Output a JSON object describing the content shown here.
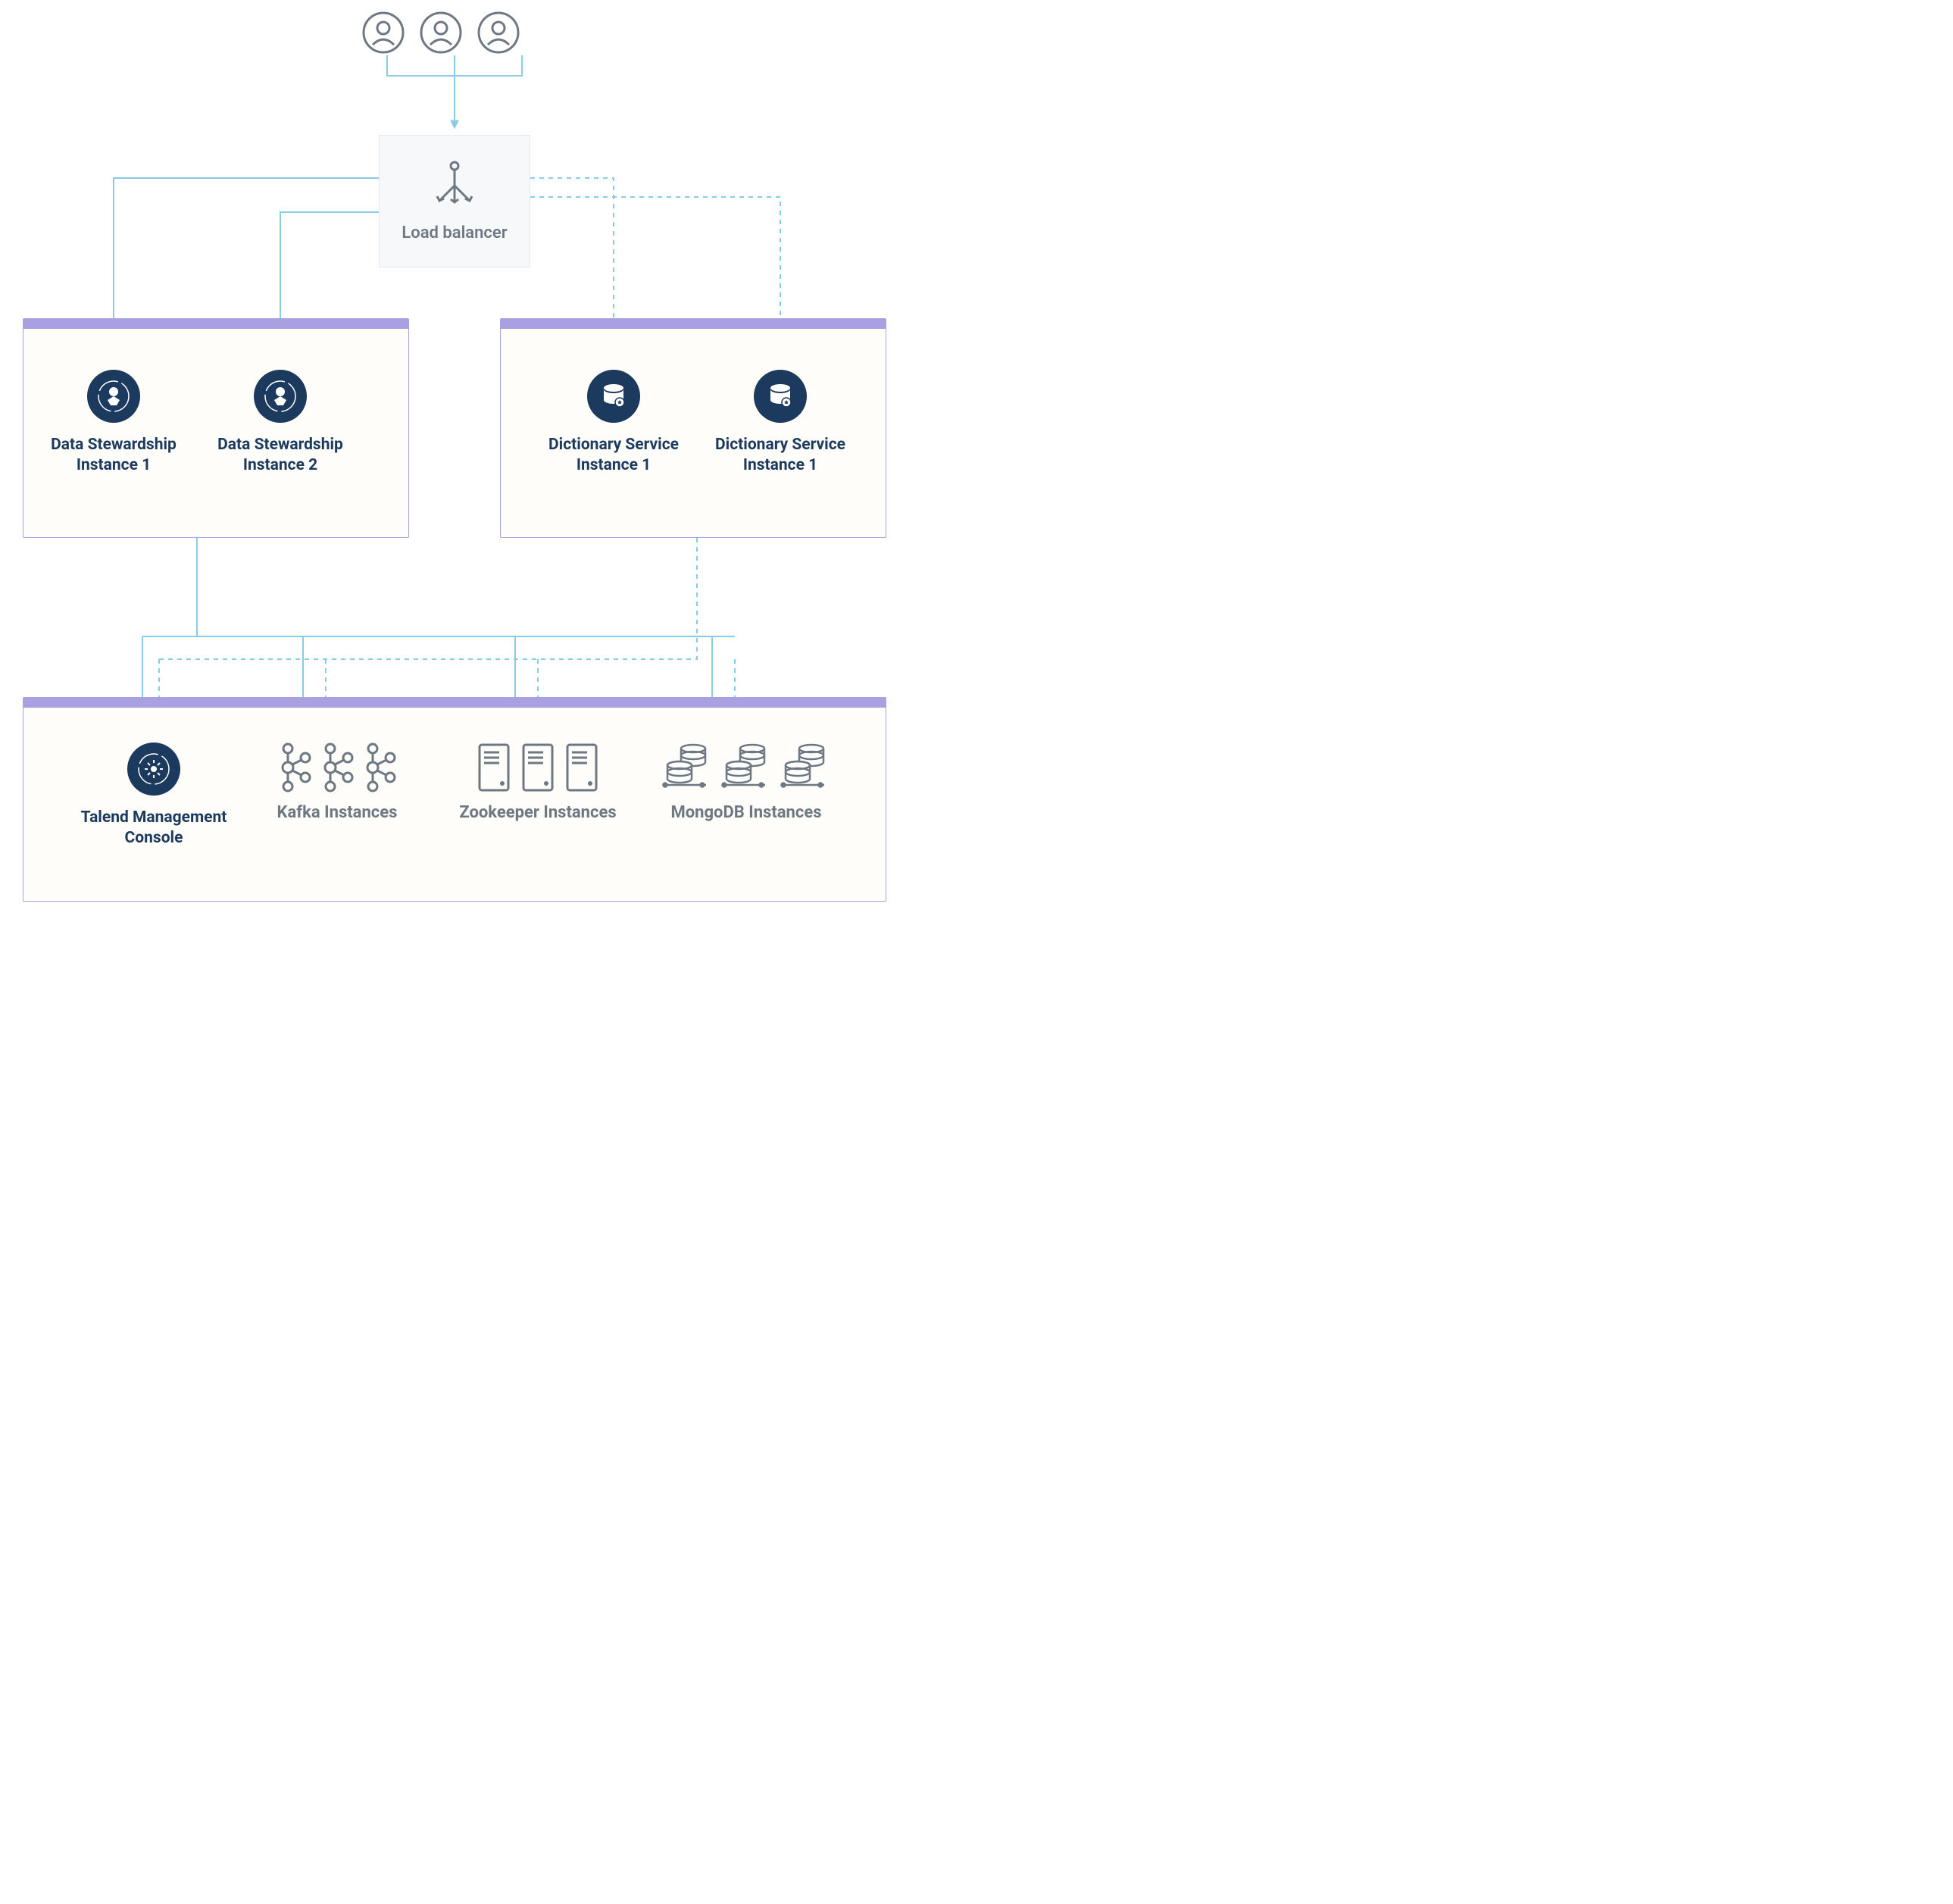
{
  "load_balancer": {
    "label": "Load balancer"
  },
  "zone_a": {
    "instances": [
      {
        "label": "Data Stewardship\nInstance 1"
      },
      {
        "label": "Data Stewardship\nInstance 2"
      }
    ]
  },
  "zone_b": {
    "instances": [
      {
        "label": "Dictionary Service\nInstance 1"
      },
      {
        "label": "Dictionary Service\nInstance 1"
      }
    ]
  },
  "bottom": {
    "tmc": {
      "label": "Talend Management\nConsole"
    },
    "kafka": {
      "label": "Kafka Instances"
    },
    "zookeeper": {
      "label": "Zookeeper Instances"
    },
    "mongodb": {
      "label": "MongoDB Instances"
    }
  },
  "colors": {
    "line_blue": "#88CCE7",
    "gray_stroke": "#6E7883",
    "navy": "#1B3A5E",
    "purple": "#A9A0E2"
  }
}
